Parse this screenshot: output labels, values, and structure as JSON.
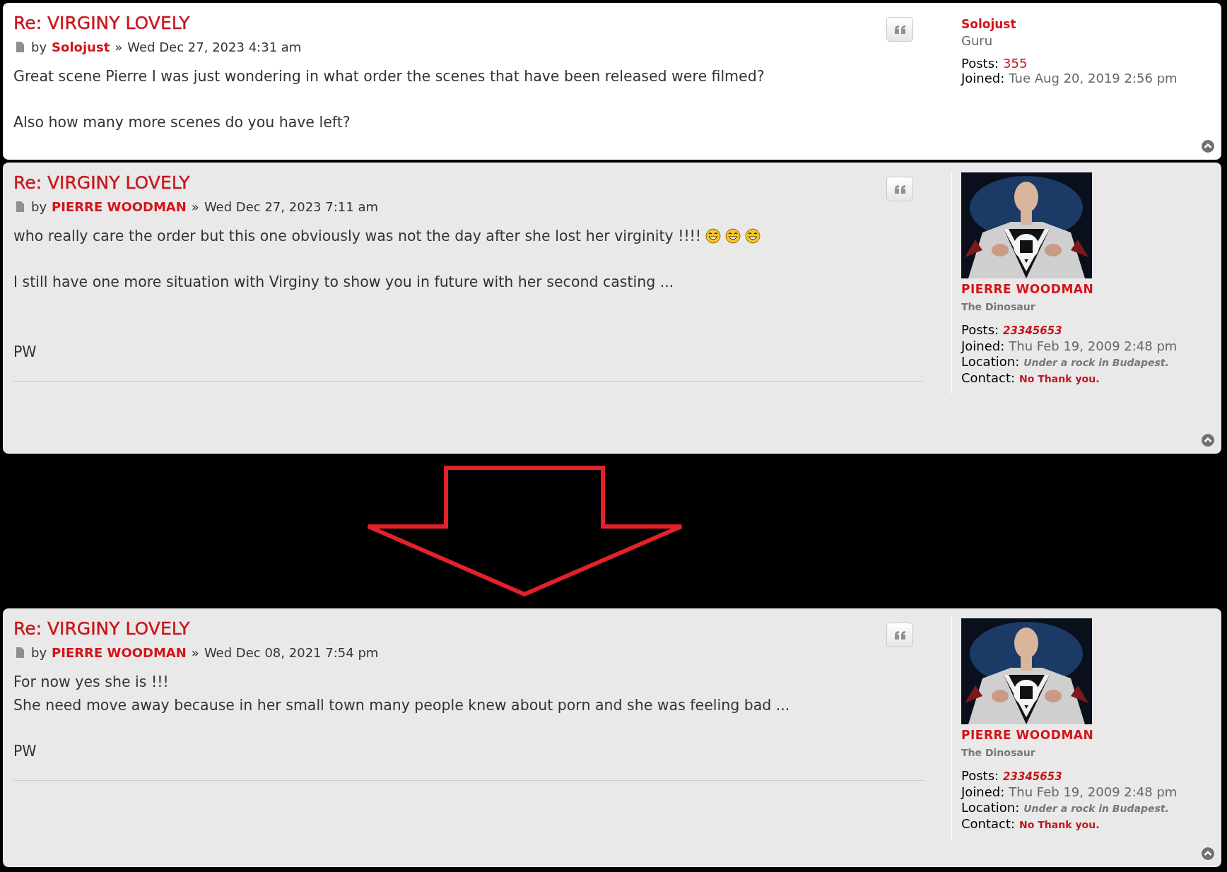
{
  "posts": [
    {
      "title": "Re: VIRGINY LOVELY",
      "by": "by",
      "author": "Solojust",
      "separator": "»",
      "date": "Wed Dec 27, 2023 4:31 am",
      "highlight": true,
      "rule": false,
      "body": [
        {
          "text": "Great scene Pierre I was just wondering in what order the scenes that have been released were filmed?"
        },
        {
          "text": "Also how many more scenes do you have left?"
        }
      ],
      "profile": {
        "username": "Solojust",
        "rank": "Guru",
        "rank_bold": false,
        "fields": [
          {
            "label": "Posts:",
            "value": "355",
            "kind": "link"
          },
          {
            "label": "Joined:",
            "value": "Tue Aug 20, 2019 2:56 pm",
            "kind": "date"
          }
        ]
      }
    },
    {
      "title": "Re: VIRGINY LOVELY",
      "by": "by",
      "author": "PIERRE WOODMAN",
      "separator": "»",
      "date": "Wed Dec 27, 2023 7:11 am",
      "highlight": false,
      "rule": true,
      "body": [
        {
          "text": "who really care the order but this one obviously was not the day after she lost her virginity !!!!",
          "smilies": [
            {
              "kind": "grin"
            },
            {
              "kind": "grin"
            },
            {
              "kind": "grin"
            }
          ]
        },
        {
          "text": "I still have one more situation with Virginy to show you in future with her second casting ..."
        },
        {
          "text": "PW"
        }
      ],
      "profile": {
        "username": "PIERRE WOODMAN",
        "rank": "The Dinosaur",
        "rank_bold": true,
        "fields": [
          {
            "label": "Posts:",
            "value": "23345653",
            "kind": "styled-link"
          },
          {
            "label": "Joined:",
            "value": "Thu Feb 19, 2009 2:48 pm",
            "kind": "date"
          },
          {
            "label": "Location:",
            "value": "Under a rock in Budapest.",
            "kind": "styled-text"
          },
          {
            "label": "Contact:",
            "value": "No Thank you.",
            "kind": "styled-red"
          }
        ]
      }
    },
    {
      "title": "Re: VIRGINY LOVELY",
      "by": "by",
      "author": "PIERRE WOODMAN",
      "separator": "»",
      "date": "Wed Dec 08, 2021 7:54 pm",
      "highlight": false,
      "rule": true,
      "body": [
        {
          "text": "For now yes she is !!!\nShe need move away because in her small town many people knew about porn and she was feeling bad ..."
        },
        {
          "text": "PW"
        }
      ],
      "profile": {
        "username": "PIERRE WOODMAN",
        "rank": "The Dinosaur",
        "rank_bold": true,
        "fields": [
          {
            "label": "Posts:",
            "value": "23345653",
            "kind": "styled-link"
          },
          {
            "label": "Joined:",
            "value": "Thu Feb 19, 2009 2:48 pm",
            "kind": "date"
          },
          {
            "label": "Location:",
            "value": "Under a rock in Budapest.",
            "kind": "styled-text"
          },
          {
            "label": "Contact:",
            "value": "No Thank you.",
            "kind": "styled-red"
          }
        ]
      }
    }
  ]
}
